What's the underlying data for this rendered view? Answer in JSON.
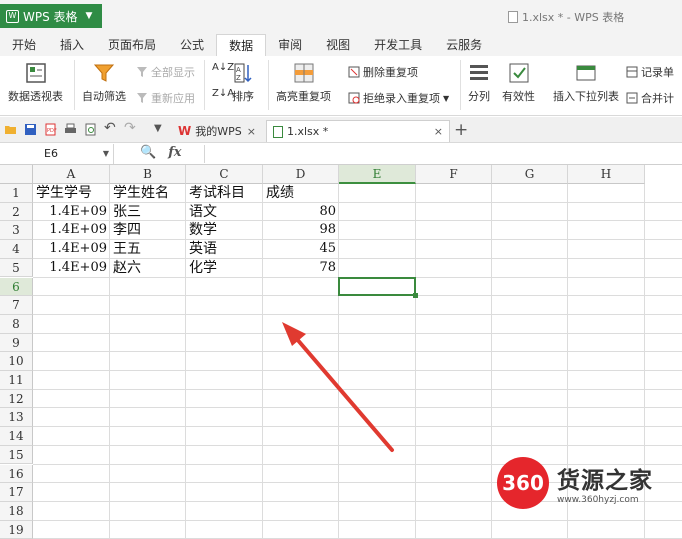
{
  "titlebar": {
    "app_name": "WPS 表格",
    "doc_title": "1.xlsx * - WPS 表格"
  },
  "ribbon_tabs": [
    "开始",
    "插入",
    "页面布局",
    "公式",
    "数据",
    "审阅",
    "视图",
    "开发工具",
    "云服务"
  ],
  "active_tab": "数据",
  "ribbon": {
    "pivot": "数据透视表",
    "autofilter": "自动筛选",
    "show_all": "全部显示",
    "reapply": "重新应用",
    "sort": "排序",
    "highlight_dup": "高亮重复项",
    "remove_dup": "删除重复项",
    "reject_dup": "拒绝录入重复项",
    "split": "分列",
    "validity": "有效性",
    "dropdown": "插入下拉列表",
    "record": "记录单",
    "merge_calc": "合并计"
  },
  "doc_tabs": [
    {
      "label": "我的WPS",
      "active": false
    },
    {
      "label": "1.xlsx *",
      "active": true
    }
  ],
  "formula_bar": {
    "cell_ref": "E6",
    "fx_label": "fx",
    "value": ""
  },
  "columns": [
    "A",
    "B",
    "C",
    "D",
    "E",
    "F",
    "G",
    "H"
  ],
  "rows": [
    "1",
    "2",
    "3",
    "4",
    "5",
    "6",
    "7",
    "8",
    "9",
    "10",
    "11",
    "12",
    "13",
    "14",
    "15",
    "16",
    "17",
    "18",
    "19"
  ],
  "selected_cell": {
    "col": "E",
    "row": "6"
  },
  "cells": {
    "A1": "学生学号",
    "B1": "学生姓名",
    "C1": "考试科目",
    "D1": "成绩",
    "A2": "1.4E+09",
    "B2": "张三",
    "C2": "语文",
    "D2": "80",
    "A3": "1.4E+09",
    "B3": "李四",
    "C3": "数学",
    "D3": "98",
    "A4": "1.4E+09",
    "B4": "王五",
    "C4": "英语",
    "D4": "45",
    "A5": "1.4E+09",
    "B5": "赵六",
    "C5": "化学",
    "D5": "78"
  },
  "annotation": {
    "color": "#e03a30"
  },
  "watermark": {
    "badge": "360",
    "name": "货源之家",
    "url": "www.360hyzj.com"
  },
  "colors": {
    "app_green": "#2f8c45",
    "selection": "#3a8a3e",
    "watermark_red": "#e5262c"
  }
}
